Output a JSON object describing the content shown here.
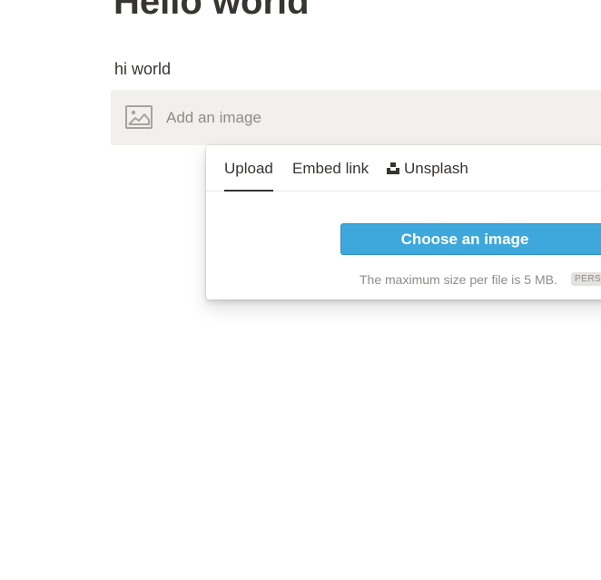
{
  "page": {
    "title": "Hello world",
    "text_block": "hi world"
  },
  "image_block": {
    "placeholder_label": "Add an image",
    "icon": "image-icon"
  },
  "popover": {
    "tabs": [
      {
        "label": "Upload",
        "active": true
      },
      {
        "label": "Embed link",
        "active": false
      },
      {
        "label": "Unsplash",
        "active": false,
        "icon": "unsplash-icon"
      }
    ],
    "upload": {
      "button_label": "Choose an image",
      "max_size_note": "The maximum size per file is 5 MB.",
      "plan_badge": "PERS"
    }
  },
  "colors": {
    "accent": "#3ea7dc",
    "text": "#37352f",
    "muted": "#8e8c86",
    "placeholder_bg": "#f1f0ed"
  }
}
